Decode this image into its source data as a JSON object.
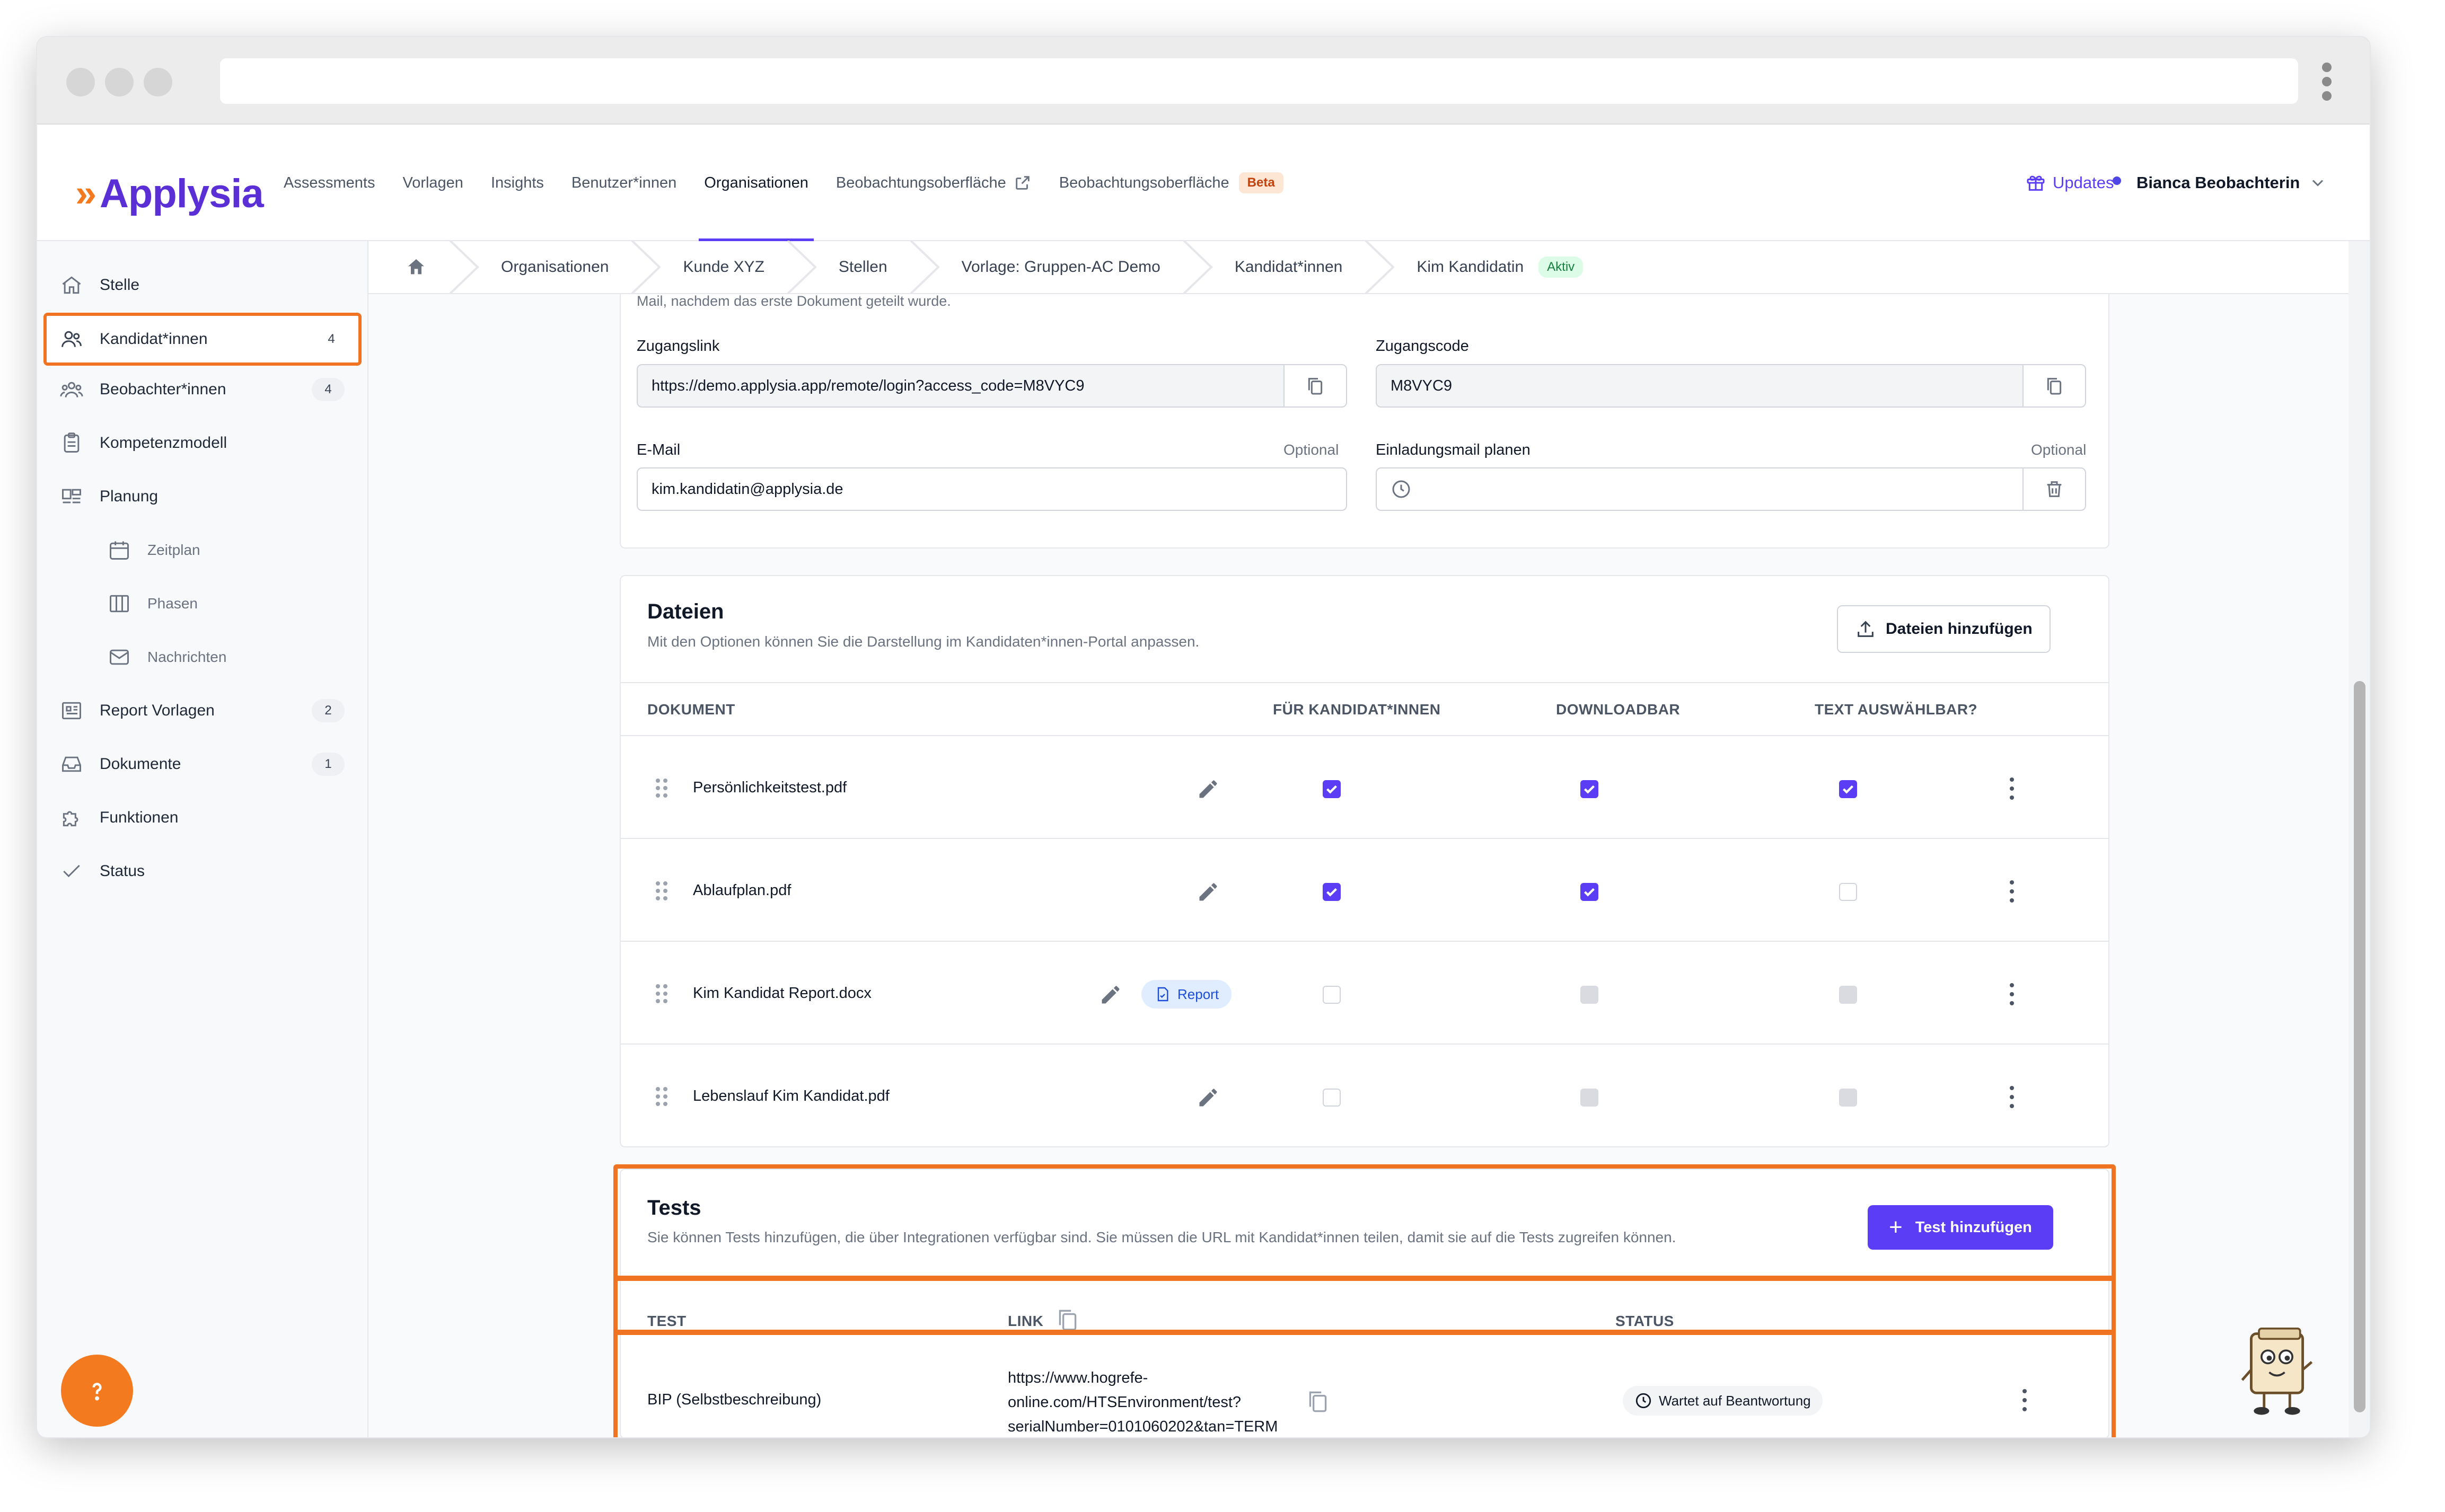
{
  "app": {
    "logo_mark": "»",
    "logo_text": "Applysia",
    "accent_color": "#5b3df5",
    "brand_orange": "#f47a20"
  },
  "topnav": {
    "items": [
      {
        "label": "Assessments"
      },
      {
        "label": "Vorlagen"
      },
      {
        "label": "Insights"
      },
      {
        "label": "Benutzer*innen"
      },
      {
        "label": "Organisationen"
      },
      {
        "label": "Beobachtungsoberfläche"
      },
      {
        "label": "Beobachtungsoberfläche",
        "badge": "Beta"
      }
    ],
    "updates_label": "Updates",
    "user_name": "Bianca Beobachterin"
  },
  "sidebar": {
    "items": [
      {
        "label": "Stelle",
        "icon": "home-icon"
      },
      {
        "label": "Kandidat*innen",
        "icon": "users-icon",
        "count": "4"
      },
      {
        "label": "Beobachter*innen",
        "icon": "group-icon",
        "count": "4"
      },
      {
        "label": "Kompetenzmodell",
        "icon": "clipboard-icon"
      },
      {
        "label": "Planung",
        "icon": "planning-icon"
      },
      {
        "label": "Zeitplan",
        "icon": "calendar-icon"
      },
      {
        "label": "Phasen",
        "icon": "columns-icon"
      },
      {
        "label": "Nachrichten",
        "icon": "mail-icon"
      },
      {
        "label": "Report Vorlagen",
        "icon": "report-icon",
        "count": "2"
      },
      {
        "label": "Dokumente",
        "icon": "inbox-icon",
        "count": "1"
      },
      {
        "label": "Funktionen",
        "icon": "puzzle-icon"
      },
      {
        "label": "Status",
        "icon": "check-icon"
      }
    ]
  },
  "breadcrumb": {
    "items": [
      "Organisationen",
      "Kunde XYZ",
      "Stellen",
      "Vorlage: Gruppen-AC Demo",
      "Kandidat*innen",
      "Kim Kandidatin"
    ],
    "status_badge": "Aktiv"
  },
  "access": {
    "intro_text": "Mail, nachdem das erste Dokument geteilt wurde.",
    "link_label": "Zugangslink",
    "link_value": "https://demo.applysia.app/remote/login?access_code=M8VYC9",
    "code_label": "Zugangscode",
    "code_value": "M8VYC9",
    "email_label": "E-Mail",
    "email_optional": "Optional",
    "email_value": "kim.kandidatin@applysia.de",
    "invite_label": "Einladungsmail planen",
    "invite_optional": "Optional"
  },
  "files": {
    "title": "Dateien",
    "subtitle": "Mit den Optionen können Sie die Darstellung im Kandidaten*innen-Portal anpassen.",
    "add_button": "Dateien hinzufügen",
    "columns": [
      "DOKUMENT",
      "FÜR KANDIDAT*INNEN",
      "DOWNLOADBAR",
      "TEXT AUSWÄHLBAR?"
    ],
    "rows": [
      {
        "name": "Persönlichkeitstest.pdf",
        "for_candidates": "checked",
        "downloadable": "checked",
        "selectable": "checked"
      },
      {
        "name": "Ablaufplan.pdf",
        "for_candidates": "checked",
        "downloadable": "checked",
        "selectable": "unchecked"
      },
      {
        "name": "Kim Kandidat Report.docx",
        "tag": "Report",
        "for_candidates": "unchecked",
        "downloadable": "disabled",
        "selectable": "disabled"
      },
      {
        "name": "Lebenslauf Kim Kandidat.pdf",
        "for_candidates": "unchecked",
        "downloadable": "disabled",
        "selectable": "disabled"
      }
    ]
  },
  "tests": {
    "title": "Tests",
    "subtitle": "Sie können Tests hinzufügen, die über Integrationen verfügbar sind. Sie müssen die URL mit Kandidat*innen teilen, damit sie auf die Tests zugreifen können.",
    "add_button": "Test hinzufügen",
    "columns": [
      "TEST",
      "LINK",
      "STATUS"
    ],
    "rows": [
      {
        "name": "BIP (Selbstbeschreibung)",
        "link_line1": "https://www.hogrefe-",
        "link_line2": "online.com/HTSEnvironment/test?",
        "link_line3": "serialNumber=0101060202&tan=TERM",
        "status": "Wartet auf Beantwortung"
      }
    ]
  },
  "help_button_icon": "question-icon"
}
